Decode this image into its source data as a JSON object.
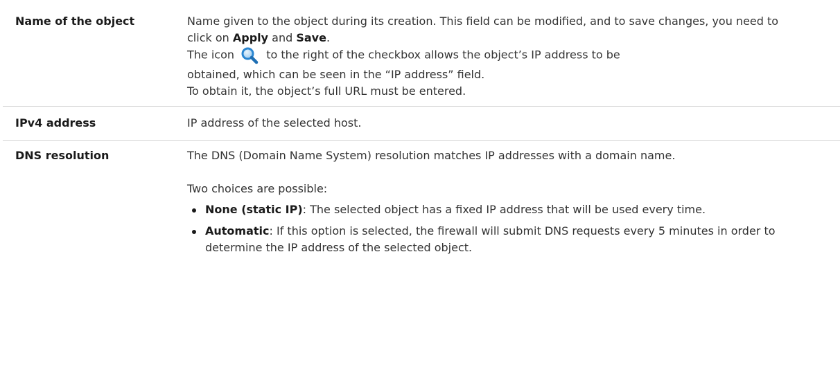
{
  "rows": [
    {
      "term": "Name of the object",
      "p1_pre": "Name given to the object during its creation. This field can be modified, and to save changes, you need to click on ",
      "p1_bold_a": "Apply",
      "p1_mid": " and ",
      "p1_bold_b": "Save",
      "p1_end": ".",
      "p2_pre": "The icon",
      "p2_icon": "search-magnifier-icon",
      "p2_post": "to the right of the checkbox allows the object’s IP address to be",
      "p3": "obtained, which can be seen in the “IP address” field.",
      "p4": "To obtain it, the object’s full URL must be entered."
    },
    {
      "term": "IPv4 address",
      "p1": "IP address of the selected host."
    },
    {
      "term": "DNS resolution",
      "p1": "The DNS (Domain Name System) resolution matches IP addresses with a domain name.",
      "p2": "Two choices are possible:",
      "choices": [
        {
          "label": "None (static IP)",
          "text": ": The selected object has a fixed IP address that will be used every time."
        },
        {
          "label": "Automatic",
          "text": ": If this option is selected, the firewall will submit DNS requests every 5 minutes in order to determine the IP address of the selected object."
        }
      ]
    }
  ],
  "colors": {
    "text": "#333333",
    "heading": "#1a1a1a",
    "divider": "#d2d2d2",
    "icon_blue": "#2a86d1"
  }
}
